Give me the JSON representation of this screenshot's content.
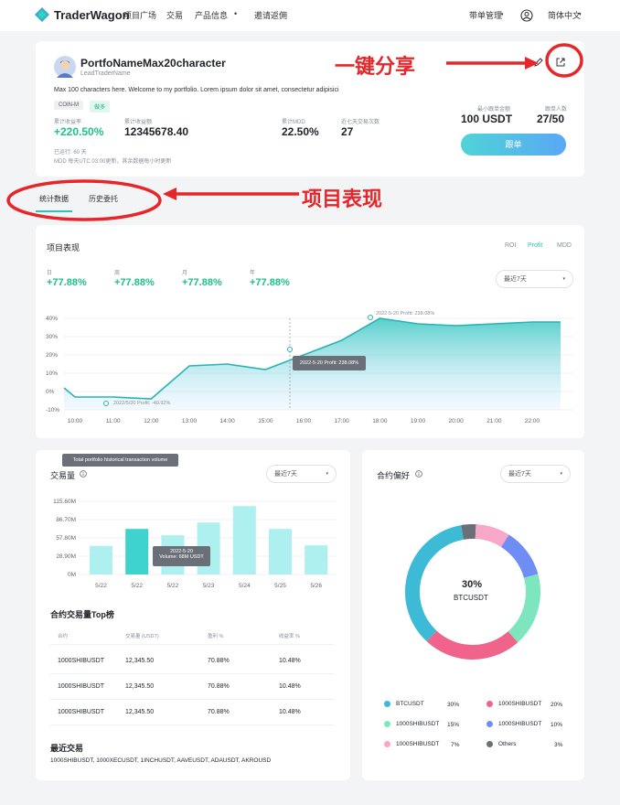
{
  "nav": {
    "brand": "TraderWagon",
    "items": [
      "项目广场",
      "交易",
      "产品信息",
      "邀请返佣"
    ],
    "dropdown_mark": "•",
    "right_items": [
      "带单管理",
      "简体中文"
    ]
  },
  "profile": {
    "name": "PortfoNameMax20character",
    "role": "LeadTraderName",
    "bio": "Max 100 characters here. Welcome to my portfolio. Lorem ipsum dolor sit amet, consectetur adipisici",
    "tags": [
      "COIN-M",
      "做多"
    ],
    "stats": [
      {
        "label": "累计收益率",
        "value": "+220.50%"
      },
      {
        "label": "累计收益额",
        "value": "12345678.40"
      },
      {
        "label": "累计MDD",
        "value": "22.50%"
      },
      {
        "label": "近七天交易次数",
        "value": "27"
      }
    ],
    "running": "已运行: 60 天",
    "note": "MDD 每天UTC 03:00更新，其余数据每小时更新",
    "min_label": "最小跟单金额",
    "min_value": "100 USDT",
    "count_label": "跟单人数",
    "count_value": "27/50",
    "follow_btn": "跟单"
  },
  "annotations": {
    "share": "一键分享",
    "perf": "项目表现"
  },
  "tabs": [
    "统计数据",
    "历史委托"
  ],
  "perf": {
    "title": "项目表现",
    "toggles": [
      "ROI",
      "Profit",
      "MDD"
    ],
    "select": "最近7天",
    "periods": [
      {
        "label": "日",
        "value": "+77.88%"
      },
      {
        "label": "周",
        "value": "+77.88%"
      },
      {
        "label": "月",
        "value": "+77.88%"
      },
      {
        "label": "年",
        "value": "+77.88%"
      }
    ],
    "tooltip": "2022-5-20  Profit: 238.08%",
    "peak_label": "2022-5-20  Profit: 238.08%",
    "low_label": "2022/5/20  Profit: -40.92%"
  },
  "volume": {
    "tooltip_top": "Total portfolio historical transaction volume",
    "title": "交易量",
    "select": "最近7天",
    "bar_tooltip_date": "2022-5-20",
    "bar_tooltip_val": "Volume: 68M USDT"
  },
  "top": {
    "title": "合约交易量Top榜",
    "headers": [
      "合约",
      "交易量 (USDT)",
      "盈利 %",
      "收益率 %"
    ],
    "rows": [
      [
        "1000SHIBUSDT",
        "12,345.50",
        "70.88%",
        "10.48%"
      ],
      [
        "1000SHIBUSDT",
        "12,345.50",
        "70.88%",
        "10.48%"
      ],
      [
        "1000SHIBUSDT",
        "12,345.50",
        "70.88%",
        "10.48%"
      ]
    ]
  },
  "recent": {
    "title": "最近交易",
    "list": "1000SHIBUSDT, 1000XECUSDT, 1INCHUSDT, AAVEUSDT, ADAUSDT, AKROUSD"
  },
  "pref": {
    "title": "合约偏好",
    "select": "最近7天",
    "center_pct": "30%",
    "center_label": "BTCUSDT",
    "legend": [
      {
        "name": "BTCUSDT",
        "pct": "30%",
        "color": "#3dbbd6"
      },
      {
        "name": "1000SHIBUSDT",
        "pct": "20%",
        "color": "#f0648c"
      },
      {
        "name": "1000SHIBUSDT",
        "pct": "15%",
        "color": "#7ee6be"
      },
      {
        "name": "1000SHIBUSDT",
        "pct": "10%",
        "color": "#6e8ef6"
      },
      {
        "name": "1000SHIBUSDT",
        "pct": "7%",
        "color": "#f7a8c8"
      },
      {
        "name": "Others",
        "pct": "3%",
        "color": "#6b7078"
      }
    ]
  },
  "chart_data": [
    {
      "type": "area",
      "title": "项目表现",
      "x": [
        "10:00",
        "11:00",
        "12:00",
        "13:00",
        "14:00",
        "15:00",
        "16:00",
        "17:00",
        "18:00",
        "19:00",
        "20:00",
        "21:00",
        "22:00"
      ],
      "y_ticks": [
        "40%",
        "30%",
        "20%",
        "10%",
        "0%",
        "-10%"
      ],
      "ylim": [
        -10,
        40
      ],
      "series": [
        {
          "values": [
            -3,
            -3,
            -4,
            14,
            15,
            12,
            20,
            28,
            40,
            37,
            36,
            37,
            38
          ]
        }
      ]
    },
    {
      "type": "bar",
      "title": "交易量",
      "categories": [
        "5/22",
        "5/22",
        "5/22",
        "5/23",
        "5/24",
        "5/25",
        "5/26"
      ],
      "y_ticks": [
        "115.60M",
        "86.70M",
        "57.80M",
        "28.90M",
        "0M"
      ],
      "ylim": [
        0,
        115.6
      ],
      "values": [
        45,
        72,
        62,
        82,
        108,
        72,
        46
      ]
    },
    {
      "type": "pie",
      "title": "合约偏好",
      "labels": [
        "BTCUSDT",
        "1000SHIBUSDT",
        "1000SHIBUSDT",
        "1000SHIBUSDT",
        "1000SHIBUSDT",
        "Others"
      ],
      "values": [
        30,
        20,
        15,
        10,
        7,
        3
      ]
    }
  ]
}
